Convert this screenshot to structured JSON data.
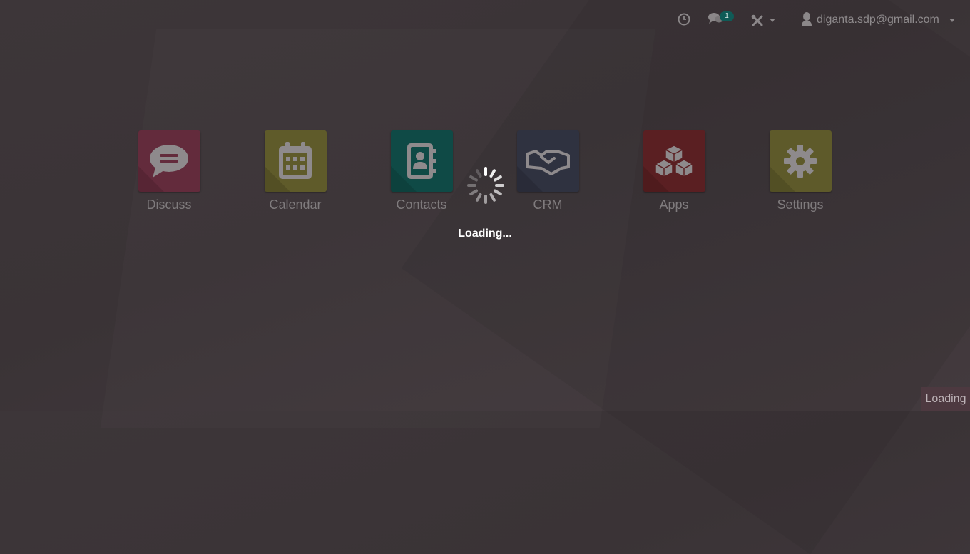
{
  "topbar": {
    "activity_icon": "clock-icon",
    "messages_icon": "chat-icon",
    "messages_count": "1",
    "tools_icon": "tools-icon",
    "user_icon": "user-icon",
    "user_email": "diganta.sdp@gmail.com"
  },
  "apps": [
    {
      "label": "Discuss",
      "icon": "discuss-icon",
      "color": "#632b3c"
    },
    {
      "label": "Calendar",
      "icon": "calendar-icon",
      "color": "#5f5b2a"
    },
    {
      "label": "Contacts",
      "icon": "contacts-icon",
      "color": "#0f4a46"
    },
    {
      "label": "CRM",
      "icon": "handshake-icon",
      "color": "#2f3240"
    },
    {
      "label": "Apps",
      "icon": "cubes-icon",
      "color": "#5a1f22"
    },
    {
      "label": "Settings",
      "icon": "gear-icon",
      "color": "#5e5a2a"
    }
  ],
  "overlay": {
    "loading_text": "Loading...",
    "corner_text": "Loading"
  },
  "colors": {
    "background": "#3b3437",
    "badge": "#0f5b57"
  }
}
